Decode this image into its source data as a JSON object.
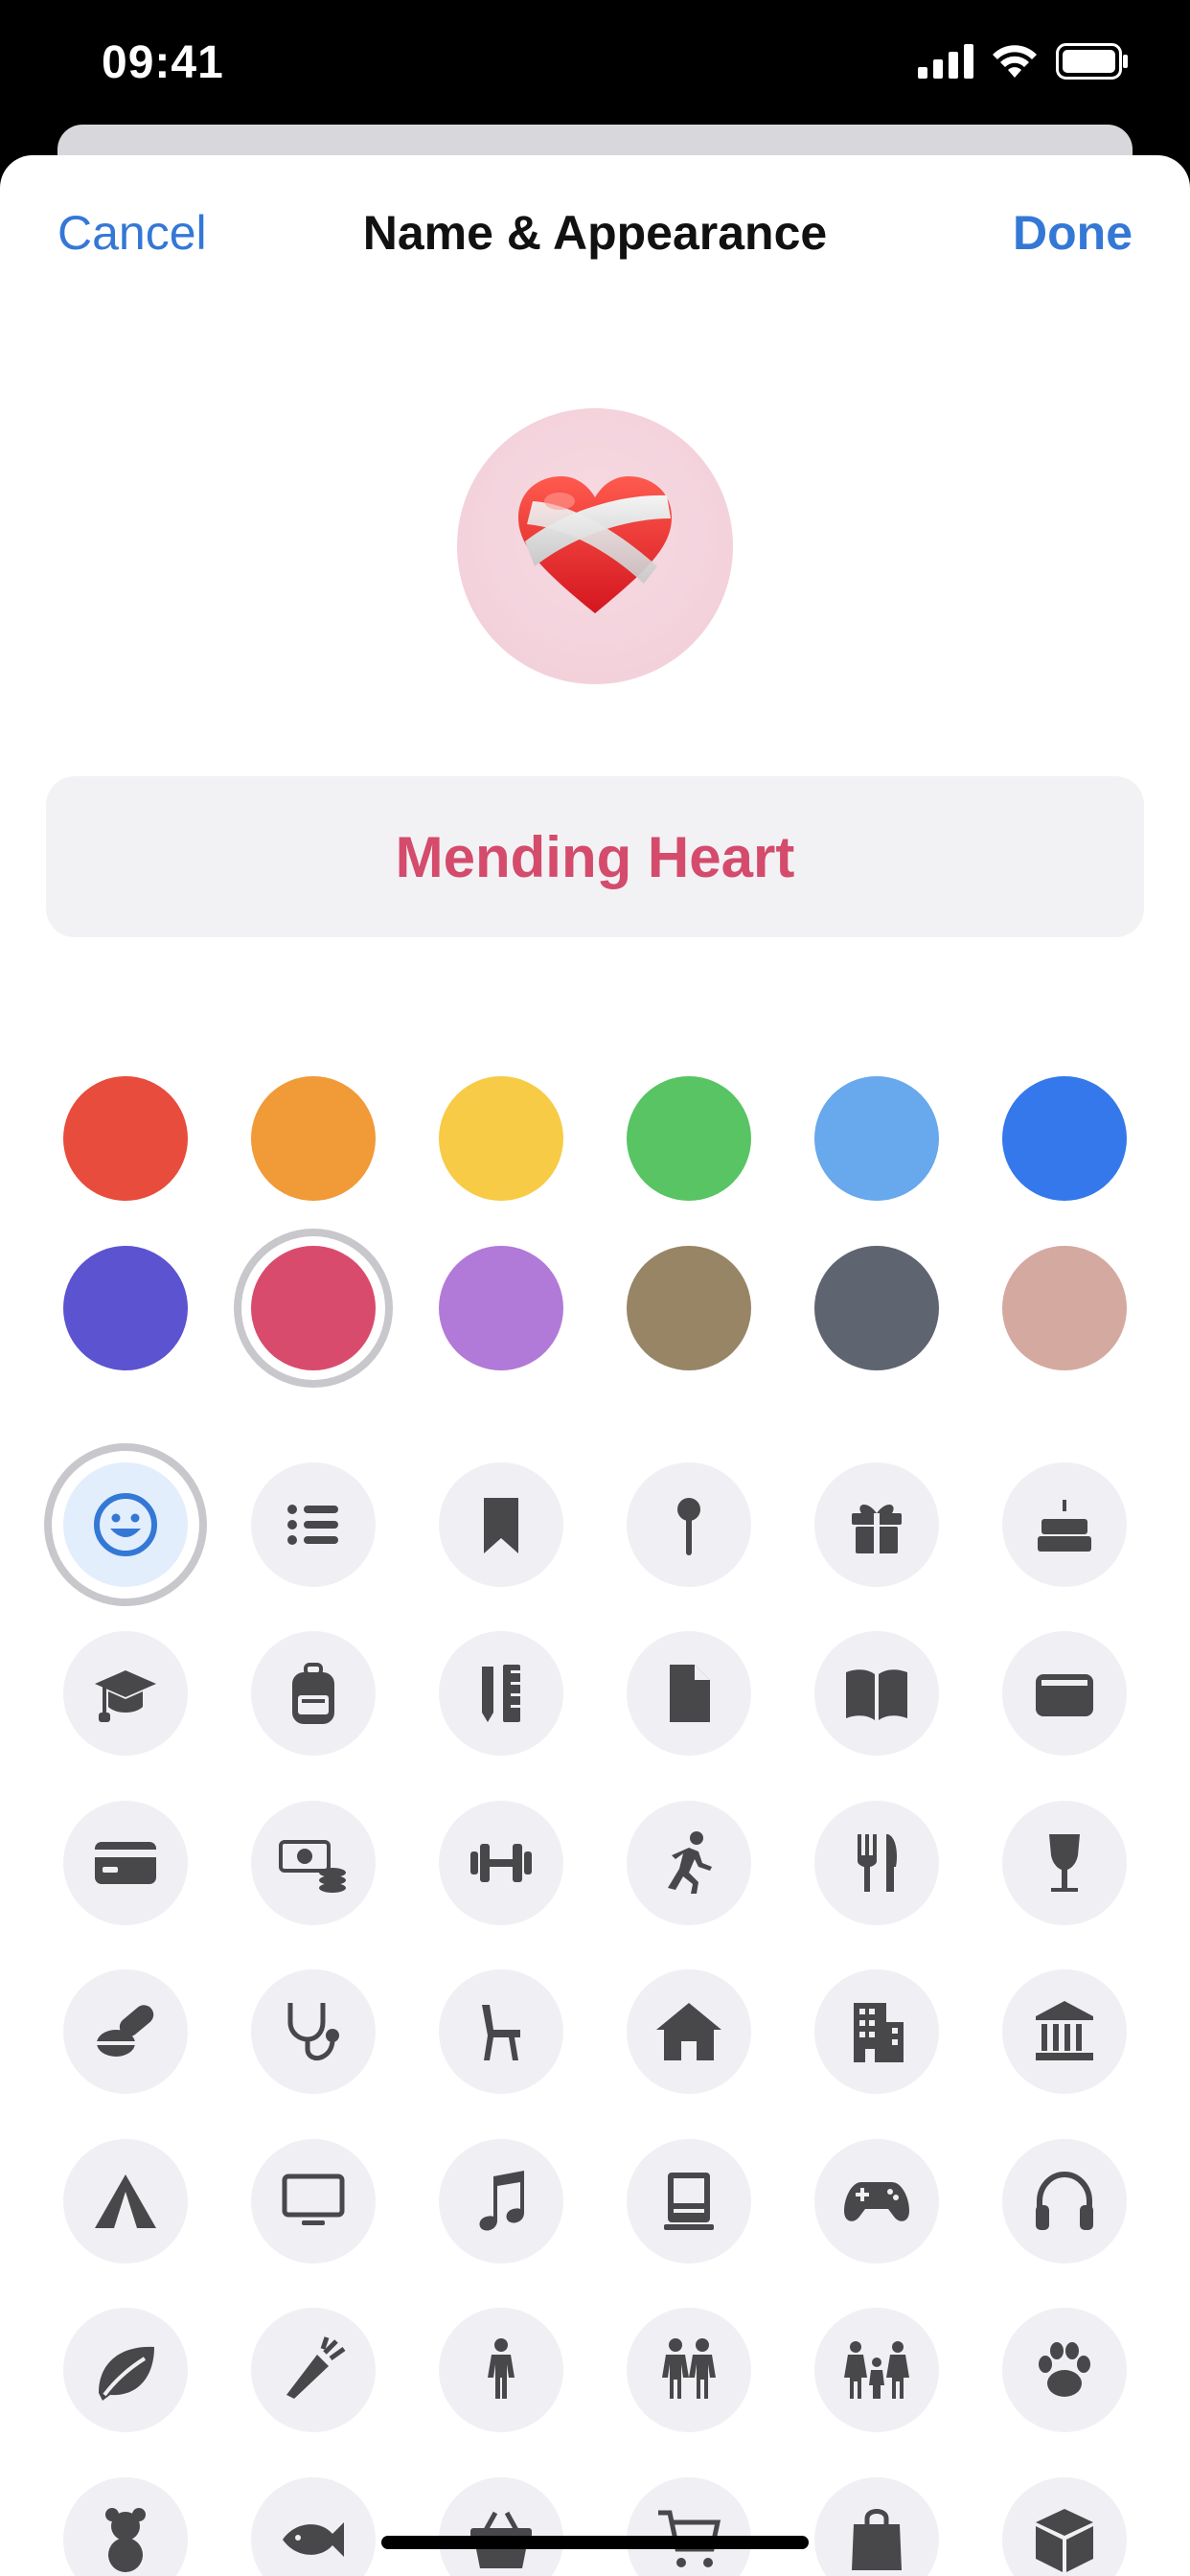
{
  "status_bar": {
    "time": "09:41"
  },
  "nav": {
    "cancel_label": "Cancel",
    "title": "Name & Appearance",
    "done_label": "Done"
  },
  "avatar": {
    "emoji": "❤️‍🩹",
    "icon_name": "mending-heart-emoji"
  },
  "name_field": {
    "value": "Mending Heart"
  },
  "colors": {
    "accent": "#3478d6",
    "name_text": "#d44b6c",
    "swatches": [
      [
        "#e84c3d",
        "#f19a38",
        "#f7cb45",
        "#58c463",
        "#68a8ec",
        "#3478ec"
      ],
      [
        "#5b53d0",
        "#d94b6c",
        "#b179d8",
        "#978566",
        "#5e6570",
        "#d4a9a0"
      ]
    ],
    "selected_swatch": "#d94b6c"
  },
  "icons": [
    [
      "smiley-face-icon",
      "list-icon",
      "bookmark-icon",
      "pin-icon",
      "gift-icon",
      "birthday-cake-icon"
    ],
    [
      "graduation-cap-icon",
      "backpack-icon",
      "pencil-ruler-icon",
      "document-icon",
      "book-icon",
      "wallet-icon"
    ],
    [
      "credit-card-icon",
      "money-icon",
      "dumbbell-icon",
      "running-person-icon",
      "fork-knife-icon",
      "wine-glass-icon"
    ],
    [
      "pills-icon",
      "stethoscope-icon",
      "chair-icon",
      "house-icon",
      "building-icon",
      "bank-icon"
    ],
    [
      "tent-icon",
      "tv-icon",
      "music-note-icon",
      "computer-icon",
      "game-controller-icon",
      "headphones-icon"
    ],
    [
      "leaf-icon",
      "carrot-icon",
      "person-icon",
      "two-people-icon",
      "family-icon",
      "paw-icon"
    ],
    [
      "teddy-bear-icon",
      "fish-icon",
      "basket-icon",
      "shopping-cart-icon",
      "shopping-bag-icon",
      "box-icon"
    ]
  ],
  "selected_icon": "smiley-face-icon"
}
